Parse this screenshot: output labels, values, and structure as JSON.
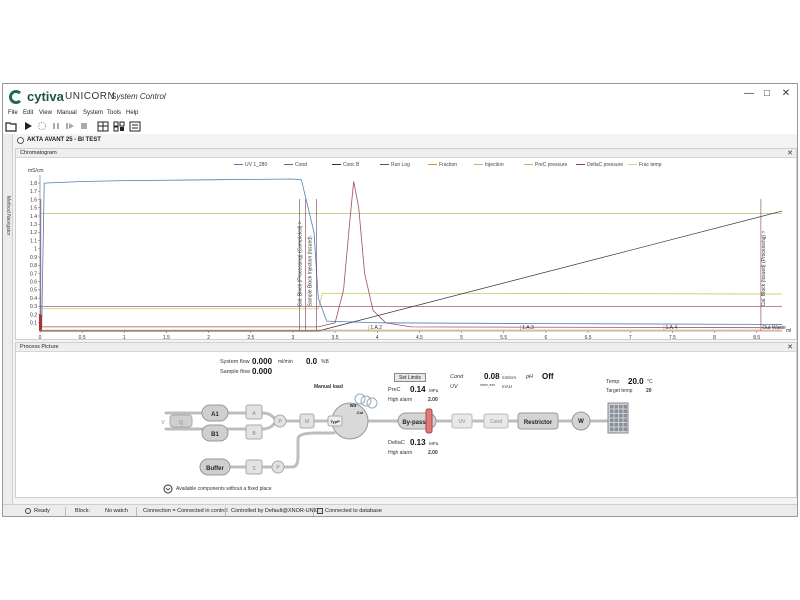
{
  "window": {
    "brand": "cytiva",
    "app": "UNICORN",
    "subtitle": "System Control",
    "minimize": "—",
    "maximize": "□",
    "close": "✕"
  },
  "menu": [
    "File",
    "Edit",
    "View",
    "Manual",
    "System",
    "Tools",
    "Help"
  ],
  "side_panel_label": "Method Navigator",
  "system_name": "AKTA AVANT 25 - BI TEST",
  "chromatogram": {
    "title": "Chromatogram",
    "close": "✕",
    "legend": [
      {
        "name": "UV 1_280",
        "color": "#4a7fb5"
      },
      {
        "name": "Cond",
        "color": "#9b4d6b"
      },
      {
        "name": "Conc B",
        "color": "#333333"
      },
      {
        "name": "Run Log",
        "color": "#7a3a5a"
      },
      {
        "name": "Fraction",
        "color": "#e08a2c"
      },
      {
        "name": "Injection",
        "color": "#a7c46a"
      },
      {
        "name": "PreC pressure",
        "color": "#b7c44a"
      },
      {
        "name": "DeltaC pressure",
        "color": "#8a3a7a"
      },
      {
        "name": "Frac temp",
        "color": "#d6d68a"
      }
    ],
    "y_unit": "mS/cm",
    "x_unit": "ml",
    "y_ticks": [
      "1.8",
      "1.7",
      "1.6",
      "1.5",
      "1.4",
      "1.3",
      "1.2",
      "1.1",
      "1",
      "0.9",
      "0.8",
      "0.7",
      "0.6",
      "0.5",
      "0.4",
      "0.3",
      "0.2",
      "0.1"
    ],
    "x_ticks": [
      "0",
      "0.5",
      "1",
      "1.5",
      "2",
      "2.5",
      "3",
      "3.5",
      "4",
      "4.5",
      "5",
      "5.5",
      "6",
      "6.5",
      "7",
      "7.5",
      "8",
      "8.5"
    ],
    "frac_labels": [
      "1.A.2",
      "1.A.3",
      "1.A.4",
      "Out Waste"
    ],
    "run_log_texts": [
      "Cal. Block (Processing) (Completed) >",
      "Sample Block Injection (Issued)",
      "Cal. Block (Issued) (Processing) >"
    ]
  },
  "process": {
    "title": "Process Picture",
    "close": "✕",
    "system_flow_label": "System flow",
    "system_flow_value": "0.000",
    "system_flow_unit": "ml/min",
    "percent_value": "0.0",
    "percent_unit": "%B",
    "sample_flow_label": "Sample flow",
    "sample_flow_value": "0.000",
    "set_limits": "Set Limits",
    "prec_label": "PreC",
    "prec_value": "0.14",
    "prec_unit": "MPa",
    "high_alarm_label": "High alarm",
    "prec_alarm": "2.00",
    "deltac_label": "DeltaC",
    "deltac_value": "0.13",
    "deltac_unit": "MPa",
    "deltac_alarm": "2.00",
    "cond_label": "Cond",
    "cond_value": "0.08",
    "cond_unit": "mS/cm",
    "ph_label": "pH",
    "ph_value": "Off",
    "uv_label": "UV",
    "uv_value": "****.***",
    "uv_unit": "mAU",
    "temp_label": "Temp",
    "temp_value": "20.0",
    "temp_unit": "°C",
    "target_temp_label": "Target temp",
    "target_temp_value": "20",
    "manual_load": "Manual load",
    "available_components": "Available components without a fixed place",
    "nodes": {
      "a1": "A1",
      "b1": "B1",
      "buffer": "Buffer",
      "a": "A",
      "b": "B",
      "s": "S",
      "p": "P",
      "p2": "P",
      "m": "M",
      "typ": "TypP",
      "w3": "W3",
      "col": "Col",
      "bypass": "By-pass",
      "uv": "UV",
      "cond": "Cond",
      "restrictor": "Restrictor",
      "w": "W",
      "q": "Q",
      "v": "V"
    }
  },
  "status": {
    "ready": "Ready",
    "block_label": "Block:",
    "block_value": "No watch",
    "connection": "Connection = Connected in control",
    "controlled_by": "Controlled by Default@XNOR-UNI04",
    "database": "Connected to database"
  }
}
